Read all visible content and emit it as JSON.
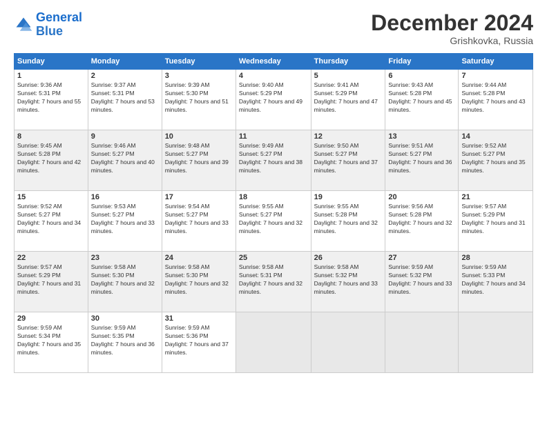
{
  "header": {
    "logo_line1": "General",
    "logo_line2": "Blue",
    "month": "December 2024",
    "location": "Grishkovka, Russia"
  },
  "days_of_week": [
    "Sunday",
    "Monday",
    "Tuesday",
    "Wednesday",
    "Thursday",
    "Friday",
    "Saturday"
  ],
  "weeks": [
    [
      {
        "day": "1",
        "sunrise": "9:36 AM",
        "sunset": "5:31 PM",
        "daylight": "7 hours and 55 minutes."
      },
      {
        "day": "2",
        "sunrise": "9:37 AM",
        "sunset": "5:31 PM",
        "daylight": "7 hours and 53 minutes."
      },
      {
        "day": "3",
        "sunrise": "9:39 AM",
        "sunset": "5:30 PM",
        "daylight": "7 hours and 51 minutes."
      },
      {
        "day": "4",
        "sunrise": "9:40 AM",
        "sunset": "5:29 PM",
        "daylight": "7 hours and 49 minutes."
      },
      {
        "day": "5",
        "sunrise": "9:41 AM",
        "sunset": "5:29 PM",
        "daylight": "7 hours and 47 minutes."
      },
      {
        "day": "6",
        "sunrise": "9:43 AM",
        "sunset": "5:28 PM",
        "daylight": "7 hours and 45 minutes."
      },
      {
        "day": "7",
        "sunrise": "9:44 AM",
        "sunset": "5:28 PM",
        "daylight": "7 hours and 43 minutes."
      }
    ],
    [
      {
        "day": "8",
        "sunrise": "9:45 AM",
        "sunset": "5:28 PM",
        "daylight": "7 hours and 42 minutes."
      },
      {
        "day": "9",
        "sunrise": "9:46 AM",
        "sunset": "5:27 PM",
        "daylight": "7 hours and 40 minutes."
      },
      {
        "day": "10",
        "sunrise": "9:48 AM",
        "sunset": "5:27 PM",
        "daylight": "7 hours and 39 minutes."
      },
      {
        "day": "11",
        "sunrise": "9:49 AM",
        "sunset": "5:27 PM",
        "daylight": "7 hours and 38 minutes."
      },
      {
        "day": "12",
        "sunrise": "9:50 AM",
        "sunset": "5:27 PM",
        "daylight": "7 hours and 37 minutes."
      },
      {
        "day": "13",
        "sunrise": "9:51 AM",
        "sunset": "5:27 PM",
        "daylight": "7 hours and 36 minutes."
      },
      {
        "day": "14",
        "sunrise": "9:52 AM",
        "sunset": "5:27 PM",
        "daylight": "7 hours and 35 minutes."
      }
    ],
    [
      {
        "day": "15",
        "sunrise": "9:52 AM",
        "sunset": "5:27 PM",
        "daylight": "7 hours and 34 minutes."
      },
      {
        "day": "16",
        "sunrise": "9:53 AM",
        "sunset": "5:27 PM",
        "daylight": "7 hours and 33 minutes."
      },
      {
        "day": "17",
        "sunrise": "9:54 AM",
        "sunset": "5:27 PM",
        "daylight": "7 hours and 33 minutes."
      },
      {
        "day": "18",
        "sunrise": "9:55 AM",
        "sunset": "5:27 PM",
        "daylight": "7 hours and 32 minutes."
      },
      {
        "day": "19",
        "sunrise": "9:55 AM",
        "sunset": "5:28 PM",
        "daylight": "7 hours and 32 minutes."
      },
      {
        "day": "20",
        "sunrise": "9:56 AM",
        "sunset": "5:28 PM",
        "daylight": "7 hours and 32 minutes."
      },
      {
        "day": "21",
        "sunrise": "9:57 AM",
        "sunset": "5:29 PM",
        "daylight": "7 hours and 31 minutes."
      }
    ],
    [
      {
        "day": "22",
        "sunrise": "9:57 AM",
        "sunset": "5:29 PM",
        "daylight": "7 hours and 31 minutes."
      },
      {
        "day": "23",
        "sunrise": "9:58 AM",
        "sunset": "5:30 PM",
        "daylight": "7 hours and 32 minutes."
      },
      {
        "day": "24",
        "sunrise": "9:58 AM",
        "sunset": "5:30 PM",
        "daylight": "7 hours and 32 minutes."
      },
      {
        "day": "25",
        "sunrise": "9:58 AM",
        "sunset": "5:31 PM",
        "daylight": "7 hours and 32 minutes."
      },
      {
        "day": "26",
        "sunrise": "9:58 AM",
        "sunset": "5:32 PM",
        "daylight": "7 hours and 33 minutes."
      },
      {
        "day": "27",
        "sunrise": "9:59 AM",
        "sunset": "5:32 PM",
        "daylight": "7 hours and 33 minutes."
      },
      {
        "day": "28",
        "sunrise": "9:59 AM",
        "sunset": "5:33 PM",
        "daylight": "7 hours and 34 minutes."
      }
    ],
    [
      {
        "day": "29",
        "sunrise": "9:59 AM",
        "sunset": "5:34 PM",
        "daylight": "7 hours and 35 minutes."
      },
      {
        "day": "30",
        "sunrise": "9:59 AM",
        "sunset": "5:35 PM",
        "daylight": "7 hours and 36 minutes."
      },
      {
        "day": "31",
        "sunrise": "9:59 AM",
        "sunset": "5:36 PM",
        "daylight": "7 hours and 37 minutes."
      },
      null,
      null,
      null,
      null
    ]
  ]
}
